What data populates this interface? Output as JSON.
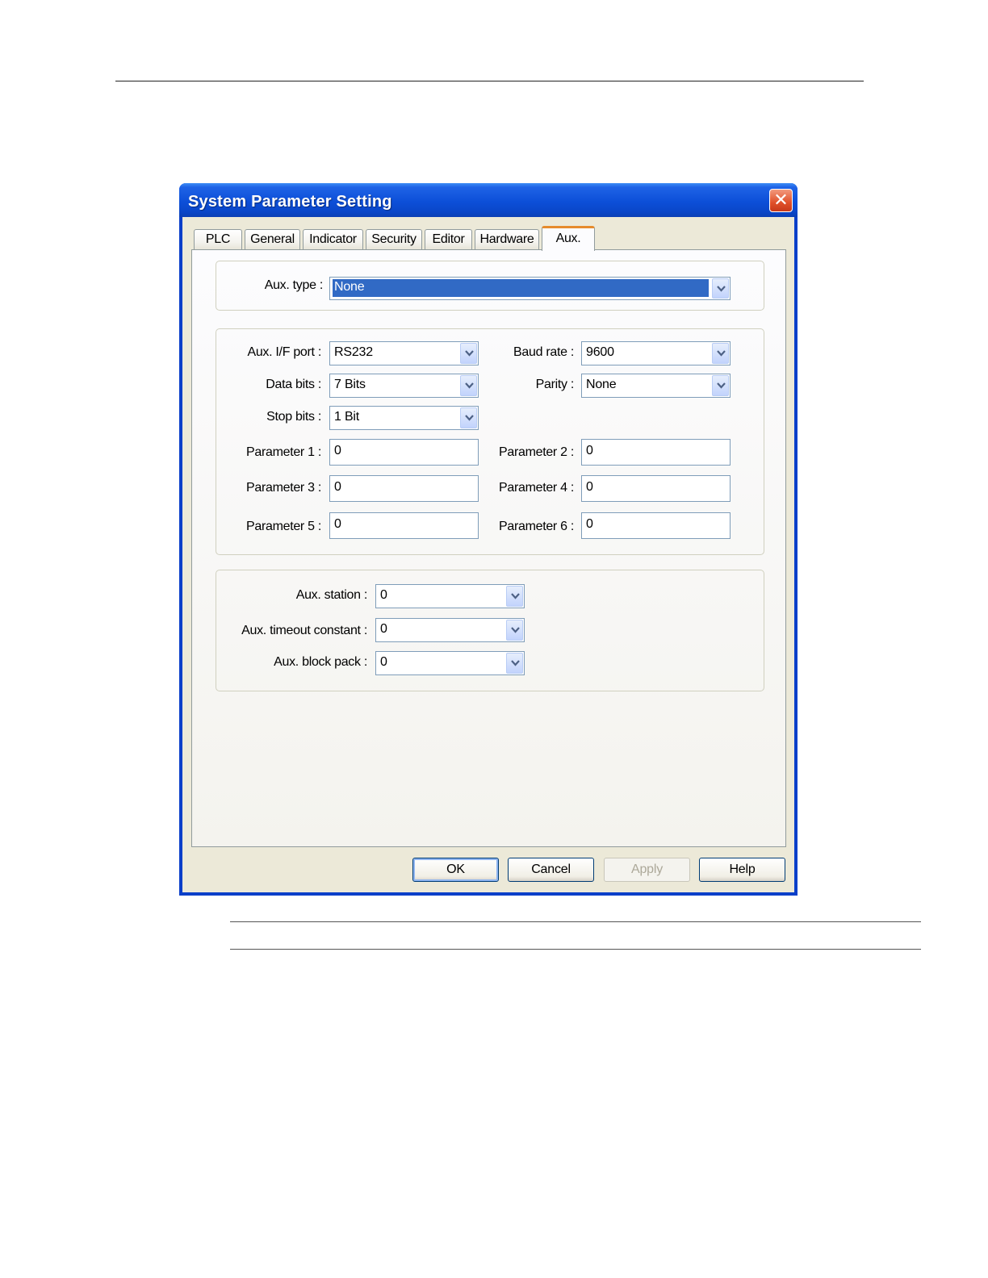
{
  "dialog": {
    "title": "System Parameter Setting",
    "close_glyph": "✕"
  },
  "tabs": [
    {
      "label": "PLC",
      "active": false
    },
    {
      "label": "General",
      "active": false
    },
    {
      "label": "Indicator",
      "active": false
    },
    {
      "label": "Security",
      "active": false
    },
    {
      "label": "Editor",
      "active": false
    },
    {
      "label": "Hardware",
      "active": false
    },
    {
      "label": "Aux.",
      "active": true
    }
  ],
  "aux_type": {
    "label": "Aux. type :",
    "value": "None"
  },
  "comm": {
    "if_port": {
      "label": "Aux. I/F port :",
      "value": "RS232"
    },
    "baud_rate": {
      "label": "Baud rate :",
      "value": "9600"
    },
    "data_bits": {
      "label": "Data bits :",
      "value": "7 Bits"
    },
    "parity": {
      "label": "Parity :",
      "value": "None"
    },
    "stop_bits": {
      "label": "Stop bits :",
      "value": "1 Bit"
    },
    "params": [
      {
        "label": "Parameter 1 :",
        "value": "0"
      },
      {
        "label": "Parameter 2 :",
        "value": "0"
      },
      {
        "label": "Parameter 3 :",
        "value": "0"
      },
      {
        "label": "Parameter 4 :",
        "value": "0"
      },
      {
        "label": "Parameter 5 :",
        "value": "0"
      },
      {
        "label": "Parameter 6 :",
        "value": "0"
      }
    ]
  },
  "station": {
    "aux_station": {
      "label": "Aux. station :",
      "value": "0"
    },
    "timeout": {
      "label": "Aux. timeout constant :",
      "value": "0"
    },
    "block_pack": {
      "label": "Aux. block pack :",
      "value": "0"
    }
  },
  "buttons": {
    "ok": "OK",
    "cancel": "Cancel",
    "apply": "Apply",
    "help": "Help"
  },
  "colors": {
    "titlebar": "#0a46c8",
    "selection": "#316ac5",
    "active_tab_accent": "#e68b2c",
    "close_button": "#e0502a"
  }
}
